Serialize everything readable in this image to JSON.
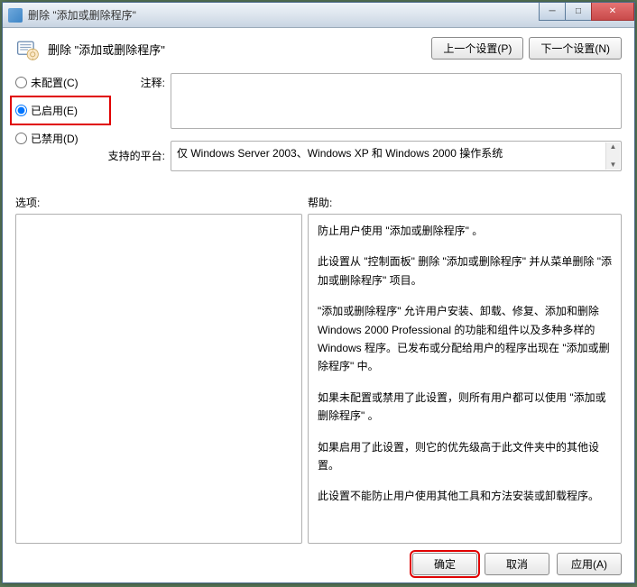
{
  "window": {
    "title": "删除 \"添加或删除程序\""
  },
  "header": {
    "title": "删除 \"添加或删除程序\"",
    "prev_btn": "上一个设置(P)",
    "next_btn": "下一个设置(N)"
  },
  "radios": {
    "not_configured": "未配置(C)",
    "enabled": "已启用(E)",
    "disabled": "已禁用(D)"
  },
  "labels": {
    "comment": "注释:",
    "platform": "支持的平台:",
    "options": "选项:",
    "help": "帮助:"
  },
  "platform_text": "仅 Windows Server 2003、Windows XP 和 Windows 2000 操作系统",
  "help": {
    "p1": "防止用户使用 \"添加或删除程序\" 。",
    "p2": "此设置从 \"控制面板\" 删除 \"添加或删除程序\" 并从菜单删除 \"添加或删除程序\" 项目。",
    "p3": "\"添加或删除程序\" 允许用户安装、卸载、修复、添加和删除 Windows 2000 Professional 的功能和组件以及多种多样的 Windows 程序。已发布或分配给用户的程序出现在 \"添加或删除程序\" 中。",
    "p4": "如果未配置或禁用了此设置，则所有用户都可以使用 \"添加或删除程序\" 。",
    "p5": "如果启用了此设置，则它的优先级高于此文件夹中的其他设置。",
    "p6": "此设置不能防止用户使用其他工具和方法安装或卸载程序。"
  },
  "footer": {
    "ok": "确定",
    "cancel": "取消",
    "apply": "应用(A)"
  }
}
